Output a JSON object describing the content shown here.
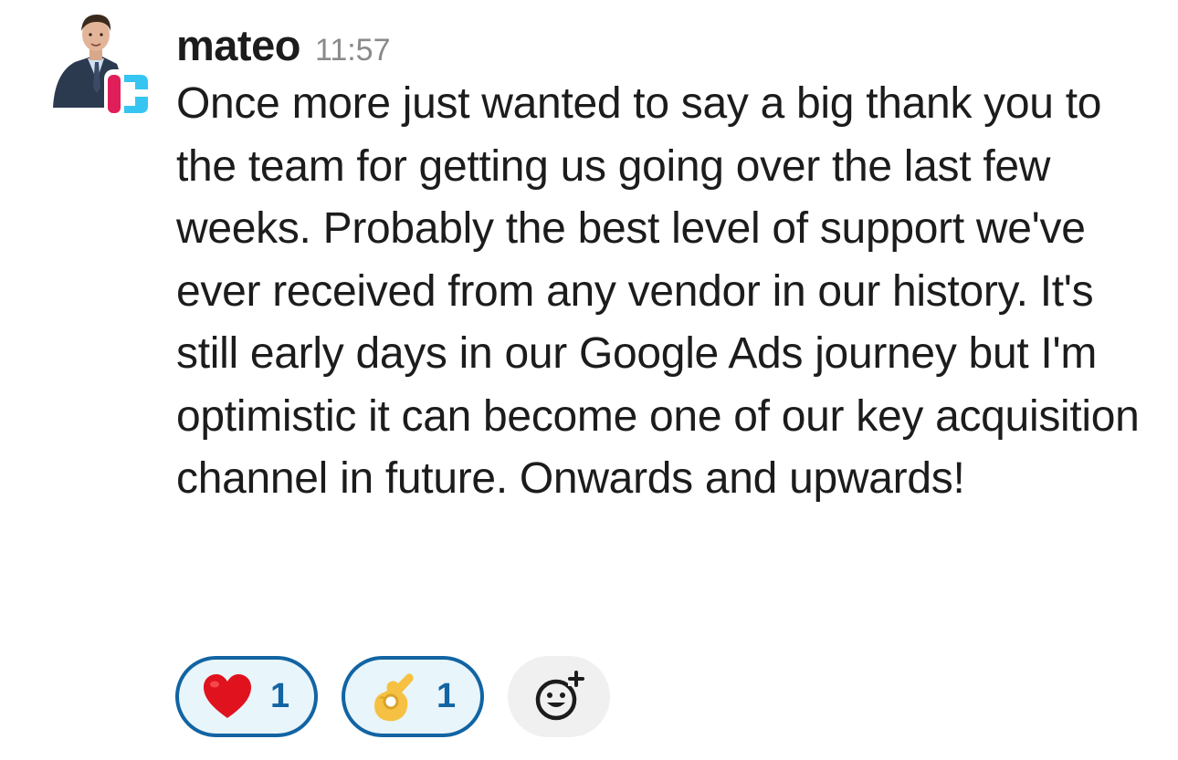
{
  "message": {
    "username": "mateo",
    "timestamp": "11:57",
    "text": "Once more just wanted to say a big thank you to the team for getting us going over the last few weeks. Probably the best level of support we've ever received from any vendor in our history. It's still early days in our Google Ads journey but I'm optimistic it can become one of our key acquisition channel in future. Onwards and upwards!"
  },
  "avatar": {
    "icon": "user-avatar-photo",
    "badge_icon": "app-logo-badge",
    "badge_colors": [
      "#e01e5a",
      "#36c5f0"
    ]
  },
  "reactions": [
    {
      "icon": "red-heart-emoji",
      "count": "1"
    },
    {
      "icon": "ok-hand-emoji",
      "count": "1"
    }
  ],
  "add_reaction": {
    "icon": "add-reaction-icon"
  },
  "colors": {
    "reaction_border": "#1264a3",
    "reaction_bg": "#e8f5fa",
    "text": "#1d1c1d",
    "timestamp": "#8a8a8c"
  }
}
